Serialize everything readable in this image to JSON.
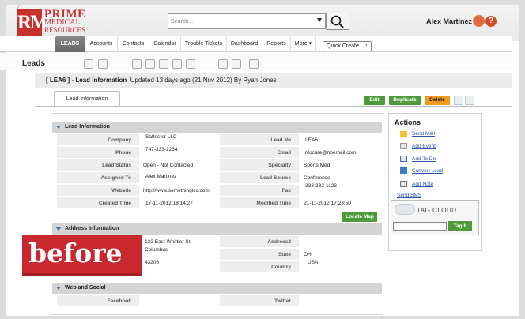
{
  "brand": {
    "mark": "RM",
    "line1": "PRIME",
    "line2": "MEDICAL",
    "line3": "RESOURCES",
    "color": "#c8312b"
  },
  "search": {
    "placeholder": "Search..."
  },
  "user": {
    "name": "Alex Martinez"
  },
  "nav": {
    "home_icon": "home-icon",
    "items": [
      "LEADS",
      "Accounts",
      "Contacts",
      "Calendar",
      "Trouble Tickets",
      "Dashboard",
      "Reports",
      "More ▾"
    ],
    "quick_create": "Quick Create... ↕"
  },
  "page": {
    "title": "Leads"
  },
  "record": {
    "id_label": "[ LEA6 ] - Lead Information",
    "updated": "Updated 13 days ago (21 Nov 2012) By Ryan Jones",
    "tab": "Lead Information",
    "buttons": {
      "edit": "Edit",
      "duplicate": "Duplicate",
      "delete": "Delete"
    }
  },
  "lead_section": {
    "title": "Lead Information",
    "rows": [
      {
        "l1": "Company",
        "v1": "Sattester LLC",
        "l2": "Lead No",
        "v2": "LEA6"
      },
      {
        "l1": "Phone",
        "v1": "747-333-1234",
        "l2": "Email",
        "v2": "infocare@noemail.com"
      },
      {
        "l1": "Lead Status",
        "v1": "Open - Not Contacted",
        "l2": "Specialty",
        "v2": "Sports Med"
      },
      {
        "l1": "Assigned To",
        "v1": "Alex Martinez",
        "l2": "Lead Source",
        "v2": "Conference"
      },
      {
        "l1": "Website",
        "v1": "http://www.somethinglcc.com",
        "l2": "Fax",
        "v2": "333-332-1123"
      },
      {
        "l1": "Created Time",
        "v1": "17-11-2012 18:14:27",
        "l2": "Modified Time",
        "v2": "21-11-2012 17:23:50"
      }
    ]
  },
  "locate_map": "Locate Map",
  "address_section": {
    "title": "Address Information",
    "rows": [
      {
        "l1": "",
        "v1": "132 East Whittier St",
        "l2": "Address2",
        "v2": ""
      },
      {
        "l1": "",
        "v1": "Columbus",
        "l2": "State",
        "v2": "OH"
      },
      {
        "l1": "",
        "v1": "43206",
        "l2": "Country",
        "v2": "USA"
      }
    ]
  },
  "web_section": {
    "title": "Web and Social",
    "rows": [
      {
        "l1": "Facebook",
        "v1": "",
        "l2": "Twitter",
        "v2": ""
      }
    ]
  },
  "actions": {
    "title": "Actions",
    "items": [
      "Send Mail",
      "Add Event",
      "Add To Do",
      "Convert Lead",
      "Add Note"
    ],
    "send_sms": "Send SMS"
  },
  "tagcloud": {
    "title": "TAG CLOUD",
    "button": "Tag It"
  },
  "overlay": {
    "label": "before"
  }
}
